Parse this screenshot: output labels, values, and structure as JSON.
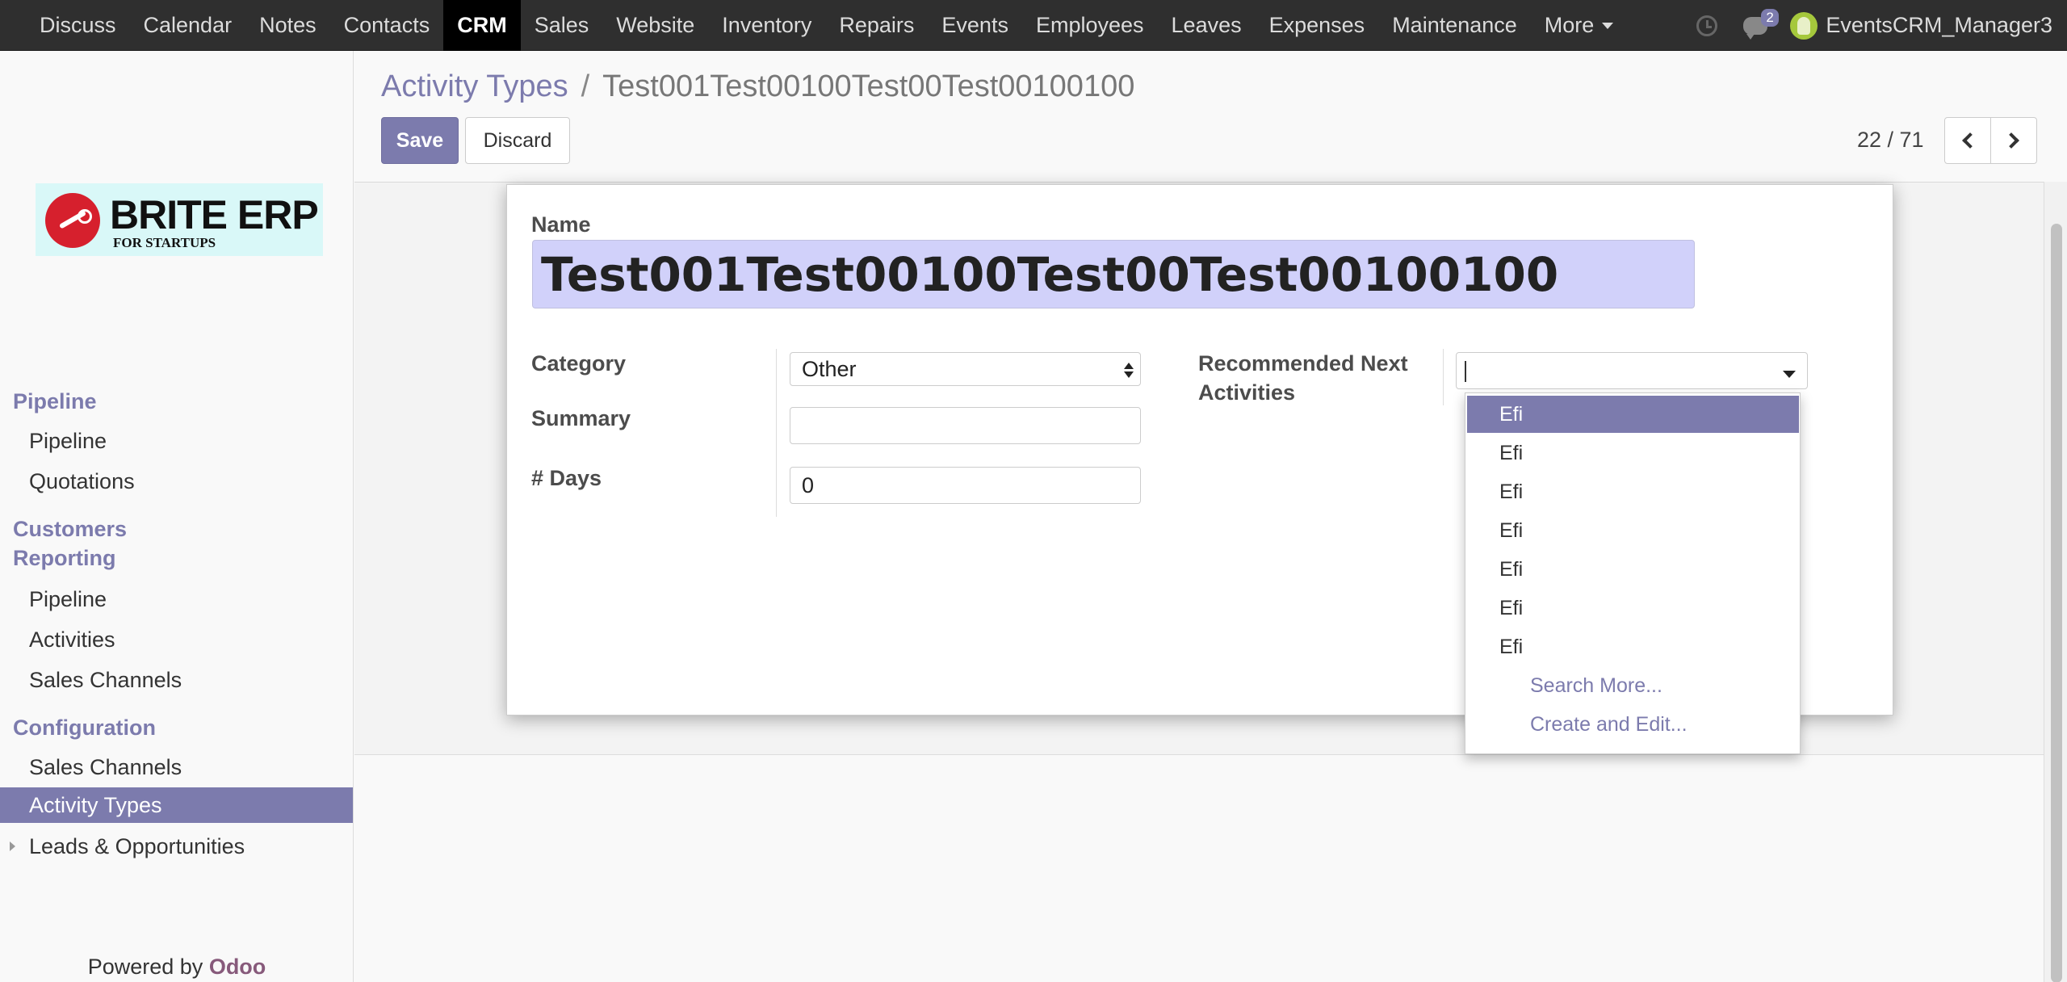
{
  "topnav": {
    "items": [
      "Discuss",
      "Calendar",
      "Notes",
      "Contacts",
      "CRM",
      "Sales",
      "Website",
      "Inventory",
      "Repairs",
      "Events",
      "Employees",
      "Leaves",
      "Expenses",
      "Maintenance",
      "More"
    ],
    "active": "CRM",
    "messages_count": "2",
    "user": "EventsCRM_Manager3"
  },
  "logo": {
    "brand": "BRITE ERP",
    "tagline": "FOR STARTUPS"
  },
  "sidebar": {
    "sections": [
      {
        "title": "Pipeline",
        "items": [
          "Pipeline",
          "Quotations"
        ]
      },
      {
        "title": "Customers Reporting",
        "title_lines": [
          "Customers",
          "Reporting"
        ],
        "items": [
          "Pipeline",
          "Activities",
          "Sales Channels"
        ]
      },
      {
        "title": "Configuration",
        "items": [
          "Sales Channels",
          "Activity Types",
          "Leads & Opportunities"
        ]
      }
    ],
    "active_item": "Activity Types",
    "powered_by": "Powered by",
    "powered_brand": "Odoo"
  },
  "breadcrumb": {
    "parent": "Activity Types",
    "separator": "/",
    "current": "Test001Test00100Test00Test00100100"
  },
  "buttons": {
    "save": "Save",
    "discard": "Discard"
  },
  "pager": {
    "text": "22 / 71"
  },
  "form": {
    "name_label": "Name",
    "name_value": "Test001Test00100Test00Test00100100",
    "category_label": "Category",
    "category_value": "Other",
    "summary_label": "Summary",
    "summary_value": "",
    "days_label": "# Days",
    "days_value": "0",
    "recommended_label_lines": [
      "Recommended Next",
      "Activities"
    ]
  },
  "dropdown": {
    "options": [
      "Efi",
      "Efi",
      "Efi",
      "Efi",
      "Efi",
      "Efi",
      "Efi"
    ],
    "search_more": "Search More...",
    "create_edit": "Create and Edit..."
  },
  "colors": {
    "accent": "#7c7bad",
    "navbar": "#2f2f2f",
    "name_input_bg": "#d1d1fa"
  }
}
